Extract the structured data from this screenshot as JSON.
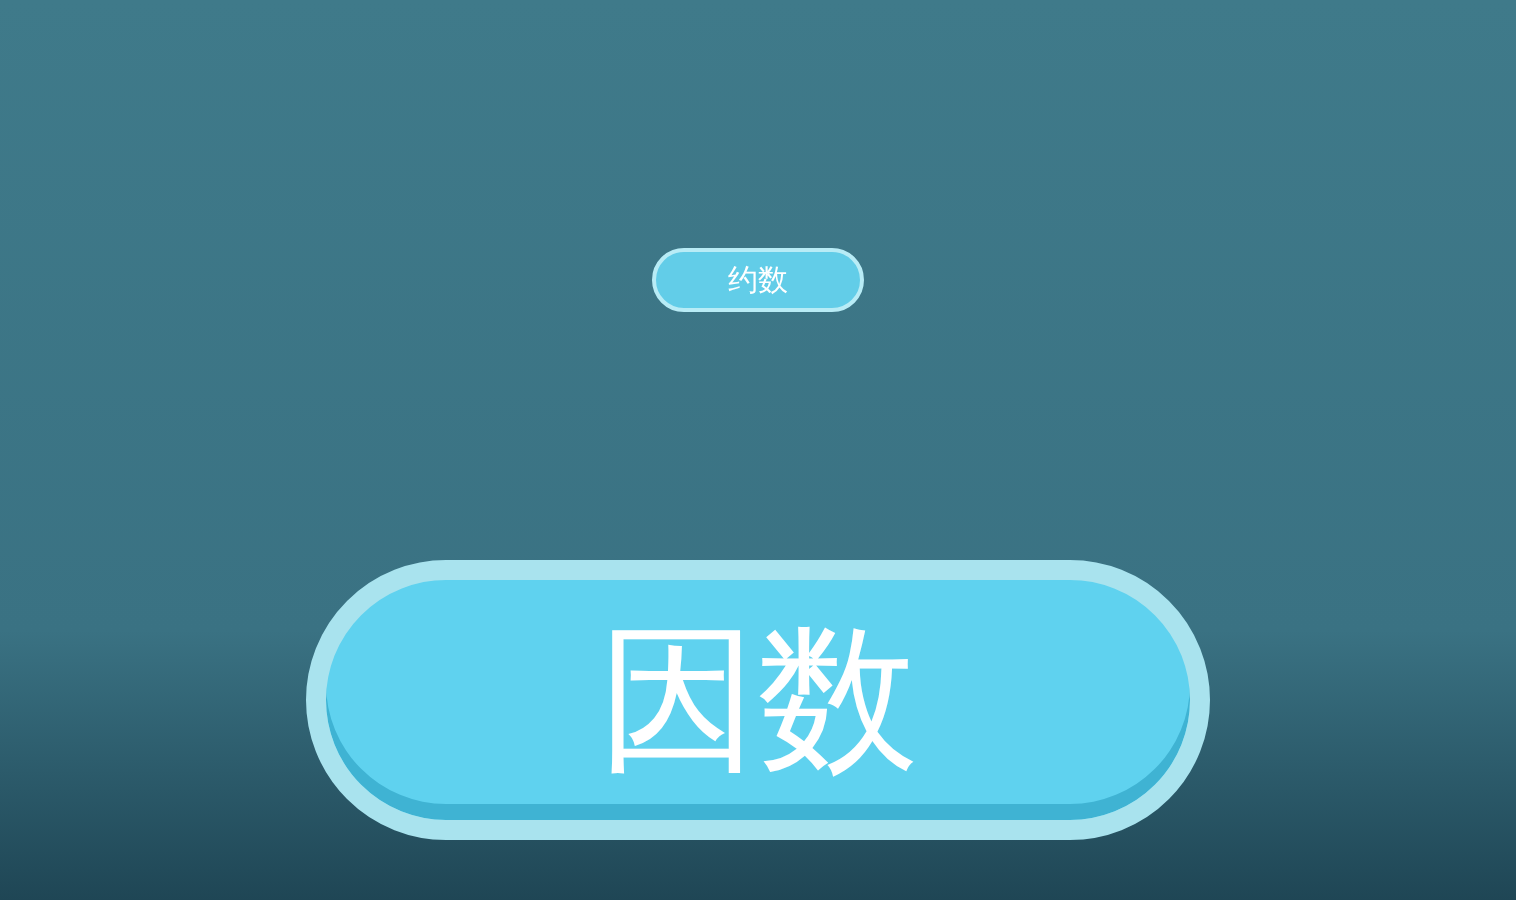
{
  "buttons": [
    {
      "label": "约数",
      "kind": "small"
    },
    {
      "label": "因数",
      "kind": "large"
    }
  ]
}
